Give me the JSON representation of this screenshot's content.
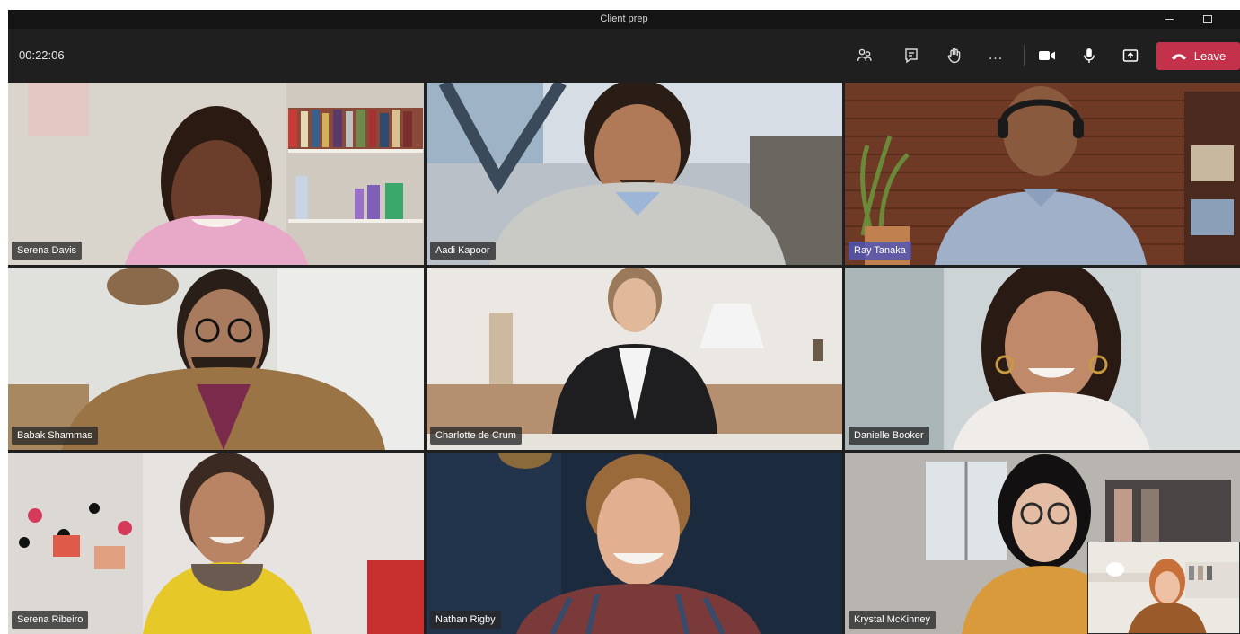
{
  "window": {
    "title": "Client prep"
  },
  "toolbar": {
    "timer": "00:22:06",
    "icons": [
      "participants-icon",
      "chat-icon",
      "raise-hand-icon",
      "more-icon",
      "camera-icon",
      "microphone-icon",
      "share-icon"
    ],
    "more_label": "...",
    "leave_label": "Leave"
  },
  "colors": {
    "leave": "#c4314b",
    "active_speaker": "#7f85f5",
    "toolbar_bg": "#1f1f1f"
  },
  "participants": [
    {
      "name": "Serena Davis"
    },
    {
      "name": "Aadi Kapoor"
    },
    {
      "name": "Ray Tanaka",
      "active_speaker": true
    },
    {
      "name": "Babak Shammas"
    },
    {
      "name": "Charlotte de Crum"
    },
    {
      "name": "Danielle Booker"
    },
    {
      "name": "Serena Ribeiro"
    },
    {
      "name": "Nathan Rigby"
    },
    {
      "name": "Krystal McKinney"
    }
  ]
}
